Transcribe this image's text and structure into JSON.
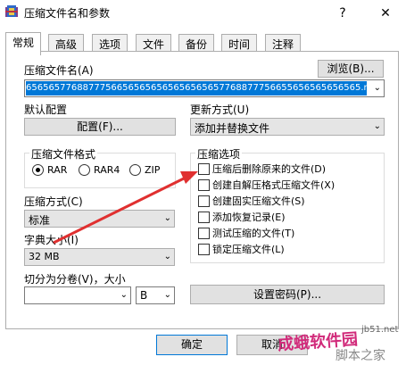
{
  "window": {
    "title": "压缩文件名和参数",
    "help_label": "?",
    "close_label": "✕"
  },
  "tabs": [
    "常规",
    "高级",
    "选项",
    "文件",
    "备份",
    "时间",
    "注释"
  ],
  "archive_name": {
    "label": "压缩文件名(A)",
    "browse_label": "浏览(B)...",
    "value": "65656577688777566565656565656565657768877756655656565656565.rar"
  },
  "profile": {
    "label": "默认配置",
    "button_label": "配置(F)..."
  },
  "update_mode": {
    "label": "更新方式(U)",
    "value": "添加并替换文件"
  },
  "format": {
    "group_title": "压缩文件格式",
    "options": [
      "RAR",
      "RAR4",
      "ZIP"
    ],
    "selected": "RAR"
  },
  "method": {
    "label": "压缩方式(C)",
    "value": "标准"
  },
  "dictionary": {
    "label": "字典大小(I)",
    "value": "32 MB"
  },
  "split": {
    "label": "切分为分卷(V)，大小",
    "value": "",
    "unit": "B"
  },
  "options": {
    "group_title": "压缩选项",
    "items": [
      {
        "label": "压缩后删除原来的文件(D)",
        "checked": false
      },
      {
        "label": "创建自解压格式压缩文件(X)",
        "checked": false
      },
      {
        "label": "创建固实压缩文件(S)",
        "checked": false
      },
      {
        "label": "添加恢复记录(E)",
        "checked": false
      },
      {
        "label": "测试压缩的文件(T)",
        "checked": false
      },
      {
        "label": "锁定压缩文件(L)",
        "checked": false
      }
    ]
  },
  "password_button": "设置密码(P)...",
  "footer": {
    "ok_label": "确定",
    "cancel_label": "取消"
  },
  "watermark": {
    "text1": "jb51.net",
    "text2": "脚本之家",
    "text3": "成蛾软件园"
  },
  "colors": {
    "selection": "#0078d7",
    "arrow": "#e03030",
    "watermark": "#d12a7a"
  }
}
